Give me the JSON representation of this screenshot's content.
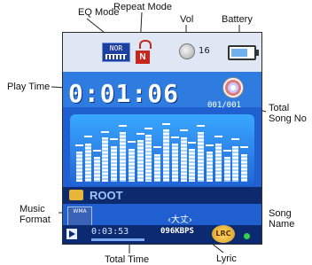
{
  "callouts": {
    "eq_mode": "EQ Mode",
    "repeat_mode": "Repeat Mode",
    "vol": "Vol",
    "battery": "Battery",
    "play_time": "Play Time",
    "total_song_no_line1": "Total",
    "total_song_no_line2": "Song No",
    "music_format_line1": "Music",
    "music_format_line2": "Format",
    "song_name_line1": "Song",
    "song_name_line2": "Name",
    "total_time": "Total Time",
    "lyric": "Lyric"
  },
  "screen": {
    "eq_label": "NOR",
    "repeat_label": "N",
    "volume": "16",
    "battery_level": 0.8,
    "play_time": "0:01:06",
    "song_count": "001/001",
    "folder": "ROOT",
    "format_label": "WMA",
    "song_name": "‹大丈›",
    "total_time": "0:03:53",
    "bitrate": "096KBPS",
    "lyric_badge": "LRC"
  },
  "spectrum": {
    "levels": [
      0.55,
      0.7,
      0.45,
      0.8,
      0.65,
      0.9,
      0.6,
      0.75,
      0.85,
      0.5,
      0.95,
      0.7,
      0.8,
      0.6,
      0.9,
      0.55,
      0.7,
      0.45,
      0.65,
      0.5
    ],
    "peaks": [
      0.62,
      0.78,
      0.52,
      0.86,
      0.72,
      0.96,
      0.68,
      0.82,
      0.92,
      0.58,
      1.0,
      0.76,
      0.88,
      0.66,
      0.96,
      0.62,
      0.78,
      0.52,
      0.72,
      0.58
    ]
  },
  "colors": {
    "screen_bg": "#1f5fcf",
    "spectrum_bar": "#ffffff",
    "lyric": "#d89a1e",
    "repeat": "#c9261d"
  }
}
